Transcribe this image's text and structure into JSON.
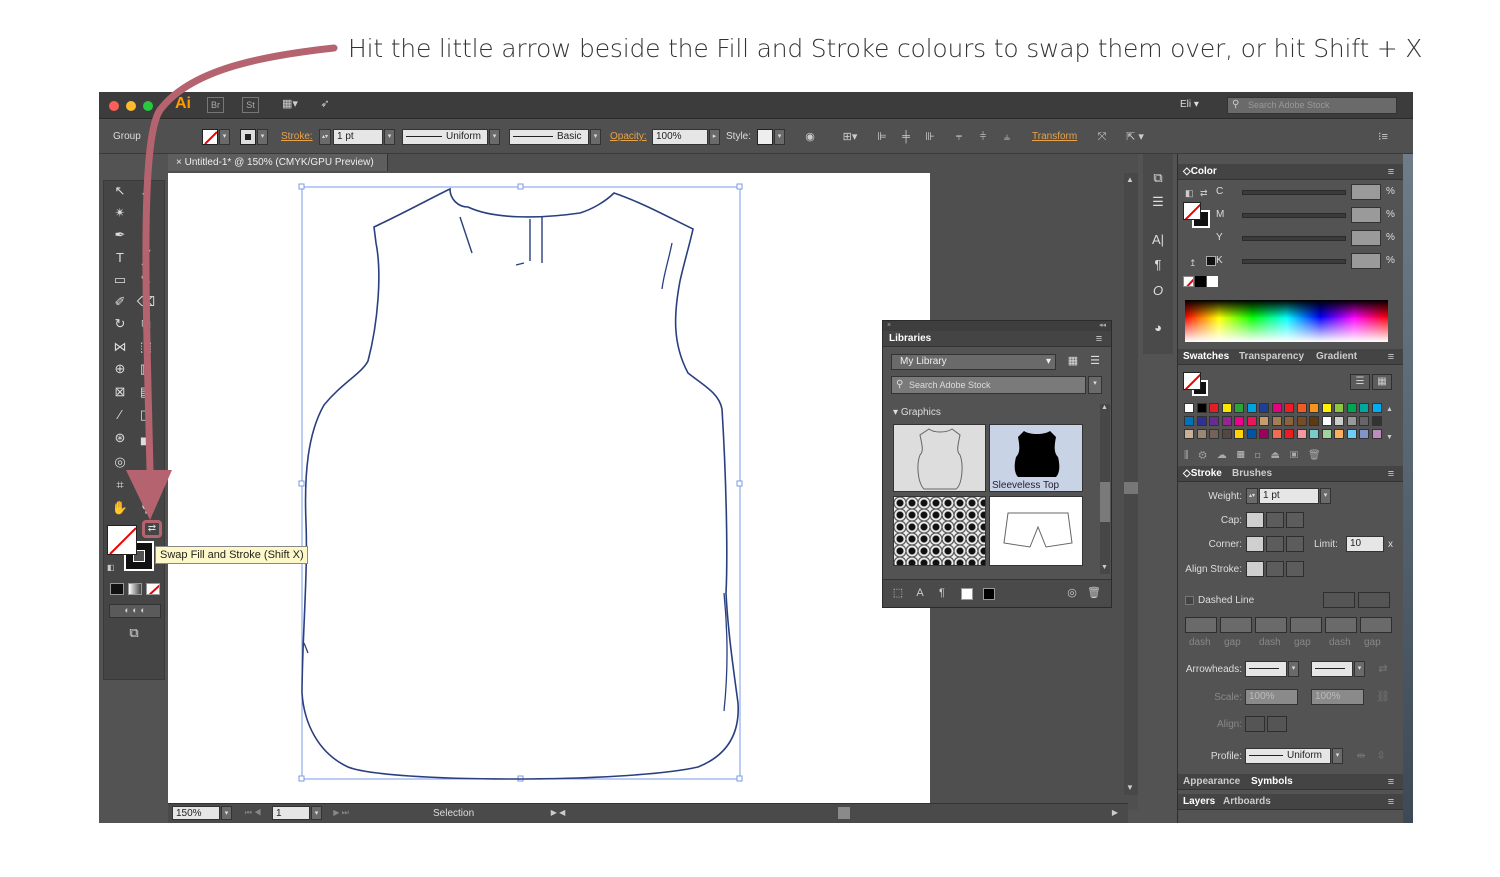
{
  "caption": "Hit the little arrow beside the Fill and Stroke colours to swap them over, or hit Shift + X",
  "titlebar": {
    "app_logo": "Ai",
    "bridge": "Br",
    "stock": "St",
    "user": "Eli",
    "search_placeholder": "Search Adobe Stock"
  },
  "controlbar": {
    "selection_type": "Group",
    "stroke_label": "Stroke:",
    "stroke_weight": "1 pt",
    "profile": "Uniform",
    "brush": "Basic",
    "opacity_label": "Opacity:",
    "opacity": "100%",
    "style_label": "Style:",
    "transform_label": "Transform"
  },
  "document": {
    "tab_title": "Untitled-1* @ 150% (CMYK/GPU Preview)"
  },
  "statusbar": {
    "zoom": "150%",
    "artboard_number": "1",
    "tool_status": "Selection"
  },
  "tooltip": {
    "text": "Swap Fill and Stroke (Shift X)"
  },
  "color_panel": {
    "title": "Color",
    "channels": [
      {
        "label": "C",
        "value": "",
        "unit": "%"
      },
      {
        "label": "M",
        "value": "",
        "unit": "%"
      },
      {
        "label": "Y",
        "value": "",
        "unit": "%"
      },
      {
        "label": "K",
        "value": "",
        "unit": "%"
      }
    ]
  },
  "swatches_panel": {
    "tabs": [
      "Swatches",
      "Transparency",
      "Gradient"
    ]
  },
  "stroke_panel": {
    "tabs": [
      "Stroke",
      "Brushes"
    ],
    "weight_label": "Weight:",
    "weight": "1 pt",
    "cap_label": "Cap:",
    "corner_label": "Corner:",
    "limit_label": "Limit:",
    "limit": "10",
    "limit_unit": "x",
    "align_label": "Align Stroke:",
    "dashed_label": "Dashed Line",
    "dash_labels": [
      "dash",
      "gap",
      "dash",
      "gap",
      "dash",
      "gap"
    ],
    "arrowheads_label": "Arrowheads:",
    "scale_label": "Scale:",
    "scale_a": "100%",
    "scale_b": "100%",
    "align2_label": "Align:",
    "profile_label": "Profile:",
    "profile": "Uniform"
  },
  "appearance_panel": {
    "tabs": [
      "Appearance",
      "Symbols"
    ]
  },
  "layers_panel": {
    "tabs": [
      "Layers",
      "Artboards"
    ]
  },
  "libraries_panel": {
    "title": "Libraries",
    "library": "My Library",
    "search_placeholder": "Search Adobe Stock",
    "section": "Graphics",
    "items": [
      "",
      "Sleeveless Top",
      "",
      ""
    ]
  },
  "colors": {
    "accent": "#b5646f",
    "ui_bg": "#535353",
    "stroke_blue": "#2a3f7f",
    "tooltip_bg": "#fdf8c8"
  }
}
